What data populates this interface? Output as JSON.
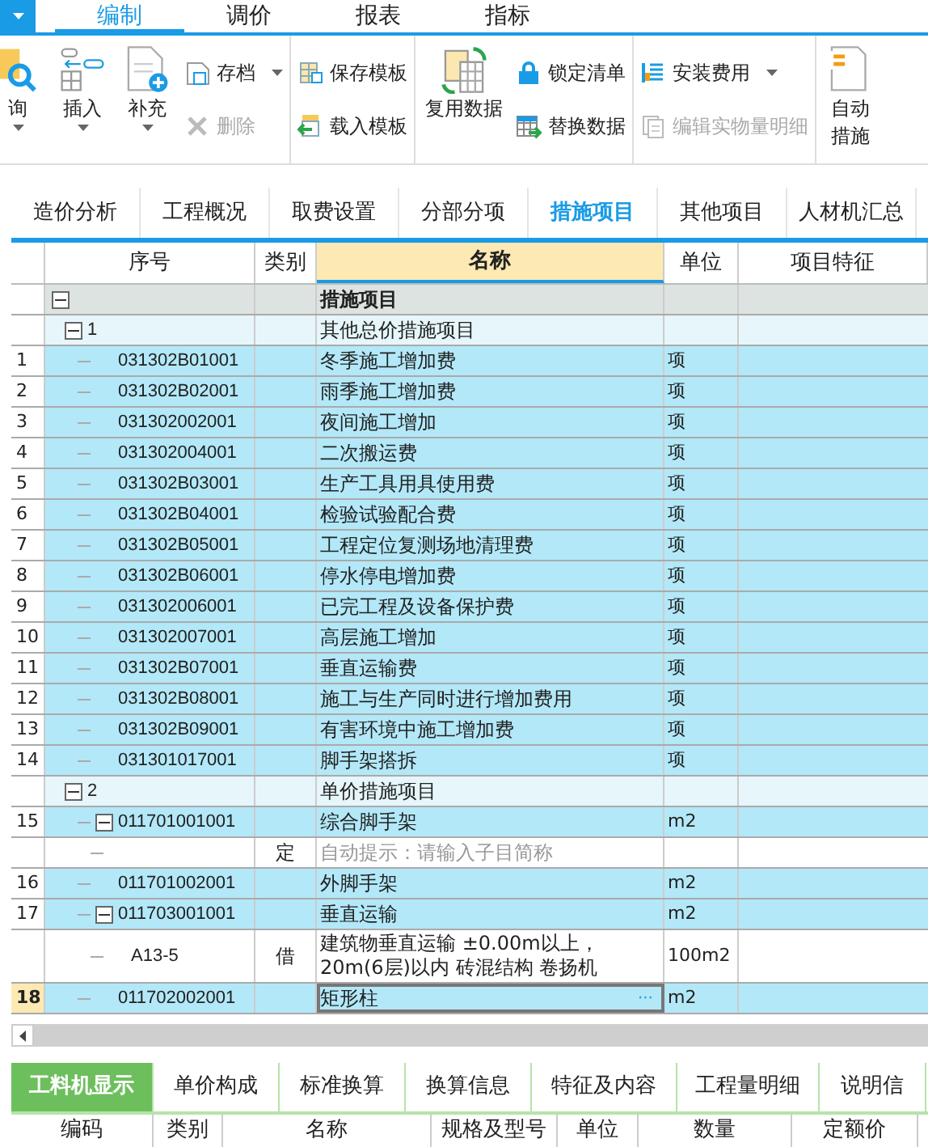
{
  "menu_tabs": [
    {
      "label": "编制",
      "selected": true
    },
    {
      "label": "调价",
      "selected": false
    },
    {
      "label": "报表",
      "selected": false
    },
    {
      "label": "指标",
      "selected": false
    }
  ],
  "ribbon": {
    "groups": [
      {
        "items": [
          {
            "kind": "big",
            "label": "询",
            "has_menu": true,
            "disabled": false
          },
          {
            "kind": "big",
            "label": "插入",
            "has_menu": true,
            "disabled": false
          },
          {
            "kind": "big",
            "label": "补充",
            "has_menu": true,
            "disabled": false
          },
          {
            "kind": "stack",
            "items": [
              {
                "label": "存档",
                "has_menu": true,
                "disabled": false
              },
              {
                "label": "删除",
                "has_menu": false,
                "disabled": true
              }
            ]
          }
        ]
      },
      {
        "items": [
          {
            "kind": "stack",
            "items": [
              {
                "label": "保存模板",
                "has_menu": false,
                "disabled": false
              },
              {
                "label": "载入模板",
                "has_menu": false,
                "disabled": false
              }
            ]
          }
        ]
      },
      {
        "items": [
          {
            "kind": "big",
            "label": "复用数据",
            "has_menu": false,
            "disabled": false
          },
          {
            "kind": "stack",
            "items": [
              {
                "label": "锁定清单",
                "has_menu": false,
                "disabled": false
              },
              {
                "label": "替换数据",
                "has_menu": false,
                "disabled": false
              }
            ]
          }
        ]
      },
      {
        "items": [
          {
            "kind": "stack",
            "items": [
              {
                "label": "安装费用",
                "has_menu": true,
                "disabled": false
              },
              {
                "label": "编辑实物量明细",
                "has_menu": false,
                "disabled": true
              }
            ]
          }
        ]
      },
      {
        "items": [
          {
            "kind": "big",
            "label": "自动",
            "label2": "措施",
            "has_menu": false,
            "disabled": false
          }
        ]
      }
    ]
  },
  "view_tabs": [
    {
      "label": "造价分析",
      "selected": false
    },
    {
      "label": "工程概况",
      "selected": false
    },
    {
      "label": "取费设置",
      "selected": false
    },
    {
      "label": "分部分项",
      "selected": false
    },
    {
      "label": "措施项目",
      "selected": true
    },
    {
      "label": "其他项目",
      "selected": false
    },
    {
      "label": "人材机汇总",
      "selected": false
    }
  ],
  "table": {
    "columns": [
      "序号",
      "类别",
      "名称",
      "单位",
      "项目特征"
    ],
    "rows": [
      {
        "kind": "group",
        "name": "措施项目",
        "expanded": true,
        "selected": false,
        "children": [
          {
            "kind": "subgroup",
            "code": "1",
            "name": "其他总价措施项目",
            "expanded": true,
            "selected": false,
            "children": [
              {
                "kind": "item",
                "number": "1",
                "code": "031302B01001",
                "name": "冬季施工增加费",
                "unit": "项",
                "selected": false
              },
              {
                "kind": "item",
                "number": "2",
                "code": "031302B02001",
                "name": "雨季施工增加费",
                "unit": "项",
                "selected": false
              },
              {
                "kind": "item",
                "number": "3",
                "code": "031302002001",
                "name": "夜间施工增加",
                "unit": "项",
                "selected": false
              },
              {
                "kind": "item",
                "number": "4",
                "code": "031302004001",
                "name": "二次搬运费",
                "unit": "项",
                "selected": false
              },
              {
                "kind": "item",
                "number": "5",
                "code": "031302B03001",
                "name": "生产工具用具使用费",
                "unit": "项",
                "selected": false
              },
              {
                "kind": "item",
                "number": "6",
                "code": "031302B04001",
                "name": "检验试验配合费",
                "unit": "项",
                "selected": false
              },
              {
                "kind": "item",
                "number": "7",
                "code": "031302B05001",
                "name": "工程定位复测场地清理费",
                "unit": "项",
                "selected": false
              },
              {
                "kind": "item",
                "number": "8",
                "code": "031302B06001",
                "name": "停水停电增加费",
                "unit": "项",
                "selected": false
              },
              {
                "kind": "item",
                "number": "9",
                "code": "031302006001",
                "name": "已完工程及设备保护费",
                "unit": "项",
                "selected": false
              },
              {
                "kind": "item",
                "number": "10",
                "code": "031302007001",
                "name": "高层施工增加",
                "unit": "项",
                "selected": false
              },
              {
                "kind": "item",
                "number": "11",
                "code": "031302B07001",
                "name": "垂直运输费",
                "unit": "项",
                "selected": false
              },
              {
                "kind": "item",
                "number": "12",
                "code": "031302B08001",
                "name": "施工与生产同时进行增加费用",
                "unit": "项",
                "selected": false
              },
              {
                "kind": "item",
                "number": "13",
                "code": "031302B09001",
                "name": "有害环境中施工增加费",
                "unit": "项",
                "selected": false
              },
              {
                "kind": "item",
                "number": "14",
                "code": "031301017001",
                "name": "脚手架搭拆",
                "unit": "项",
                "selected": false
              }
            ]
          },
          {
            "kind": "subgroup",
            "code": "2",
            "name": "单价措施项目",
            "expanded": true,
            "selected": false,
            "children": [
              {
                "kind": "item",
                "number": "15",
                "code": "011701001001",
                "name": "综合脚手架",
                "unit": "m2",
                "expanded": true,
                "selected": false,
                "children": [
                  {
                    "kind": "sub",
                    "category": "定",
                    "placeholder": "自动提示：请输入子目简称",
                    "selected": false
                  }
                ]
              },
              {
                "kind": "item",
                "number": "16",
                "code": "011701002001",
                "name": "外脚手架",
                "unit": "m2",
                "selected": false
              },
              {
                "kind": "item",
                "number": "17",
                "code": "011703001001",
                "name": "垂直运输",
                "unit": "m2",
                "expanded": true,
                "selected": false,
                "children": [
                  {
                    "kind": "sub",
                    "code": "A13-5",
                    "category": "借",
                    "name": "建筑物垂直运输 ±0.00m以上，20m(6层)以内 砖混结构 卷扬机",
                    "unit": "100m2",
                    "selected": false
                  }
                ]
              },
              {
                "kind": "item",
                "number": "18",
                "code": "011702002001",
                "name": "矩形柱",
                "unit": "m2",
                "selected": true,
                "action": "···"
              }
            ]
          }
        ]
      }
    ]
  },
  "detail_tabs": [
    {
      "label": "工料机显示",
      "selected": true
    },
    {
      "label": "单价构成",
      "selected": false
    },
    {
      "label": "标准换算",
      "selected": false
    },
    {
      "label": "换算信息",
      "selected": false
    },
    {
      "label": "特征及内容",
      "selected": false
    },
    {
      "label": "工程量明细",
      "selected": false
    },
    {
      "label": "说明信",
      "selected": false
    }
  ],
  "detail_columns": [
    "编码",
    "类别",
    "名称",
    "规格及型号",
    "单位",
    "数量",
    "定额价"
  ]
}
